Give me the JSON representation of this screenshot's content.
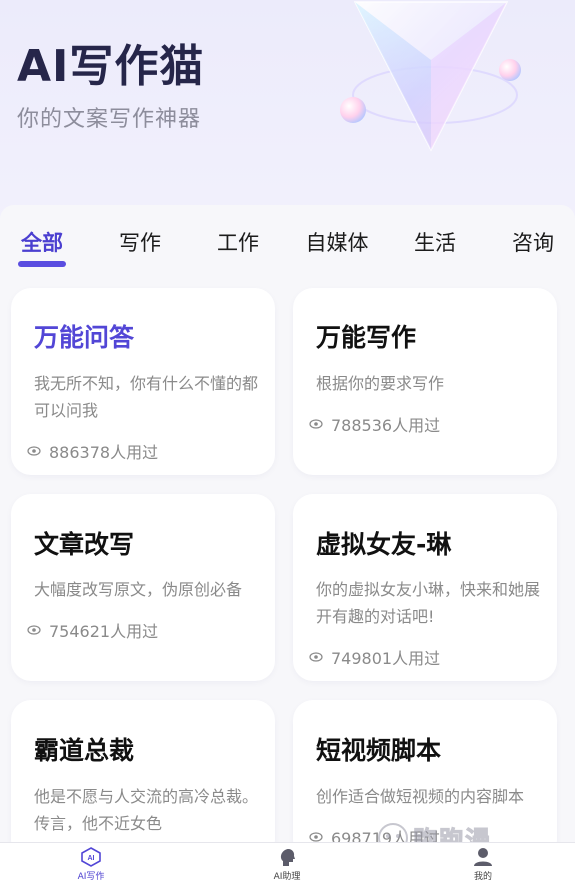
{
  "header": {
    "title": "AI写作猫",
    "subtitle": "你的文案写作神器"
  },
  "tabs": [
    {
      "label": "全部",
      "active": true
    },
    {
      "label": "写作",
      "active": false
    },
    {
      "label": "工作",
      "active": false
    },
    {
      "label": "自媒体",
      "active": false
    },
    {
      "label": "生活",
      "active": false
    },
    {
      "label": "咨询",
      "active": false
    }
  ],
  "cards": [
    {
      "title": "万能问答",
      "desc": "我无所不知，你有什么不懂的都可以问我",
      "usage": "886378人用过",
      "highlight": true
    },
    {
      "title": "万能写作",
      "desc": "根据你的要求写作",
      "usage": "788536人用过",
      "highlight": false
    },
    {
      "title": "文章改写",
      "desc": "大幅度改写原文，伪原创必备",
      "usage": "754621人用过",
      "highlight": false
    },
    {
      "title": "虚拟女友-琳",
      "desc": "你的虚拟女友小琳，快来和她展开有趣的对话吧!",
      "usage": "749801人用过",
      "highlight": false
    },
    {
      "title": "霸道总裁",
      "desc": "他是不愿与人交流的高冷总裁。传言，他不近女色",
      "usage": "",
      "highlight": false
    },
    {
      "title": "短视频脚本",
      "desc": "创作适合做短视频的内容脚本",
      "usage": "698719人用过",
      "highlight": false
    }
  ],
  "bottom_nav": [
    {
      "label": "AI写作",
      "icon": "ai-write-icon",
      "active": true
    },
    {
      "label": "AI助理",
      "icon": "assistant-head-icon",
      "active": false
    },
    {
      "label": "我的",
      "icon": "user-icon",
      "active": false
    }
  ],
  "watermark": "跑跑漫",
  "colors": {
    "accent": "#5246d6",
    "title_dark": "#26264a",
    "muted": "#8a8a8a"
  }
}
